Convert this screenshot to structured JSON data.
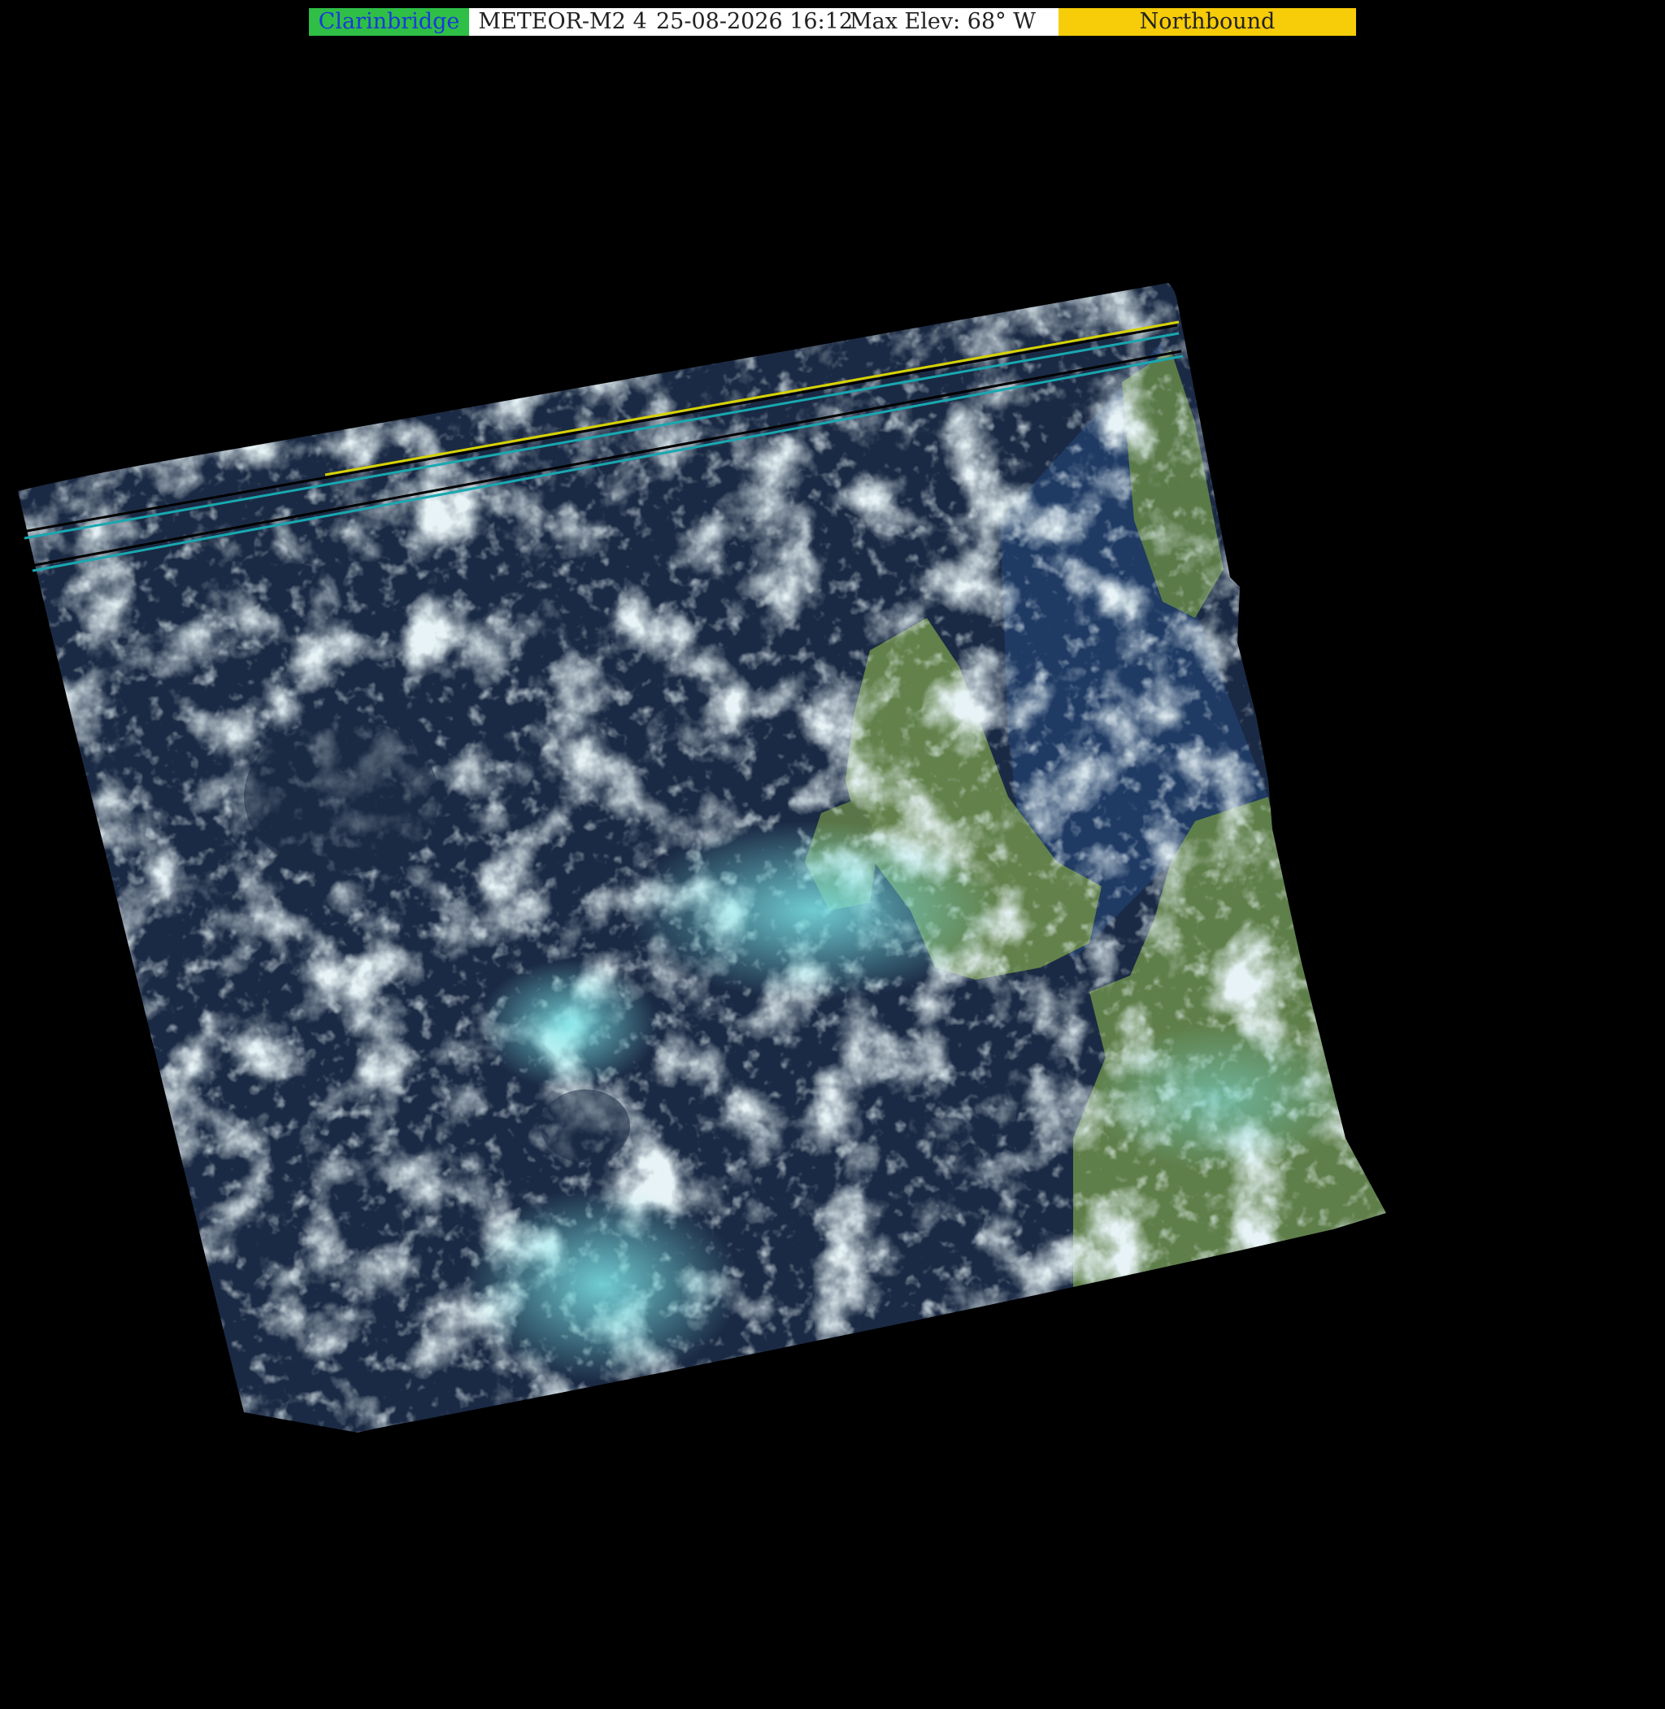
{
  "header": {
    "station": "Clarinbridge",
    "satellite": "METEOR-M2 4",
    "datetime": "25-08-2026 16:12",
    "max_elevation": "Max Elev: 68° W",
    "direction": "Northbound"
  },
  "colors": {
    "station_bg": "#2fbf47",
    "station_text": "#1a3ad8",
    "direction_bg": "#f7cc08",
    "ocean": "#1b2a44",
    "cloud": "#c9dfe0",
    "cloud_cyan": "#6fe3e6",
    "land": "#5f7f4a",
    "overlay_black": "#000000",
    "overlay_yellow": "#d8d200",
    "overlay_teal": "#18a8b0"
  }
}
